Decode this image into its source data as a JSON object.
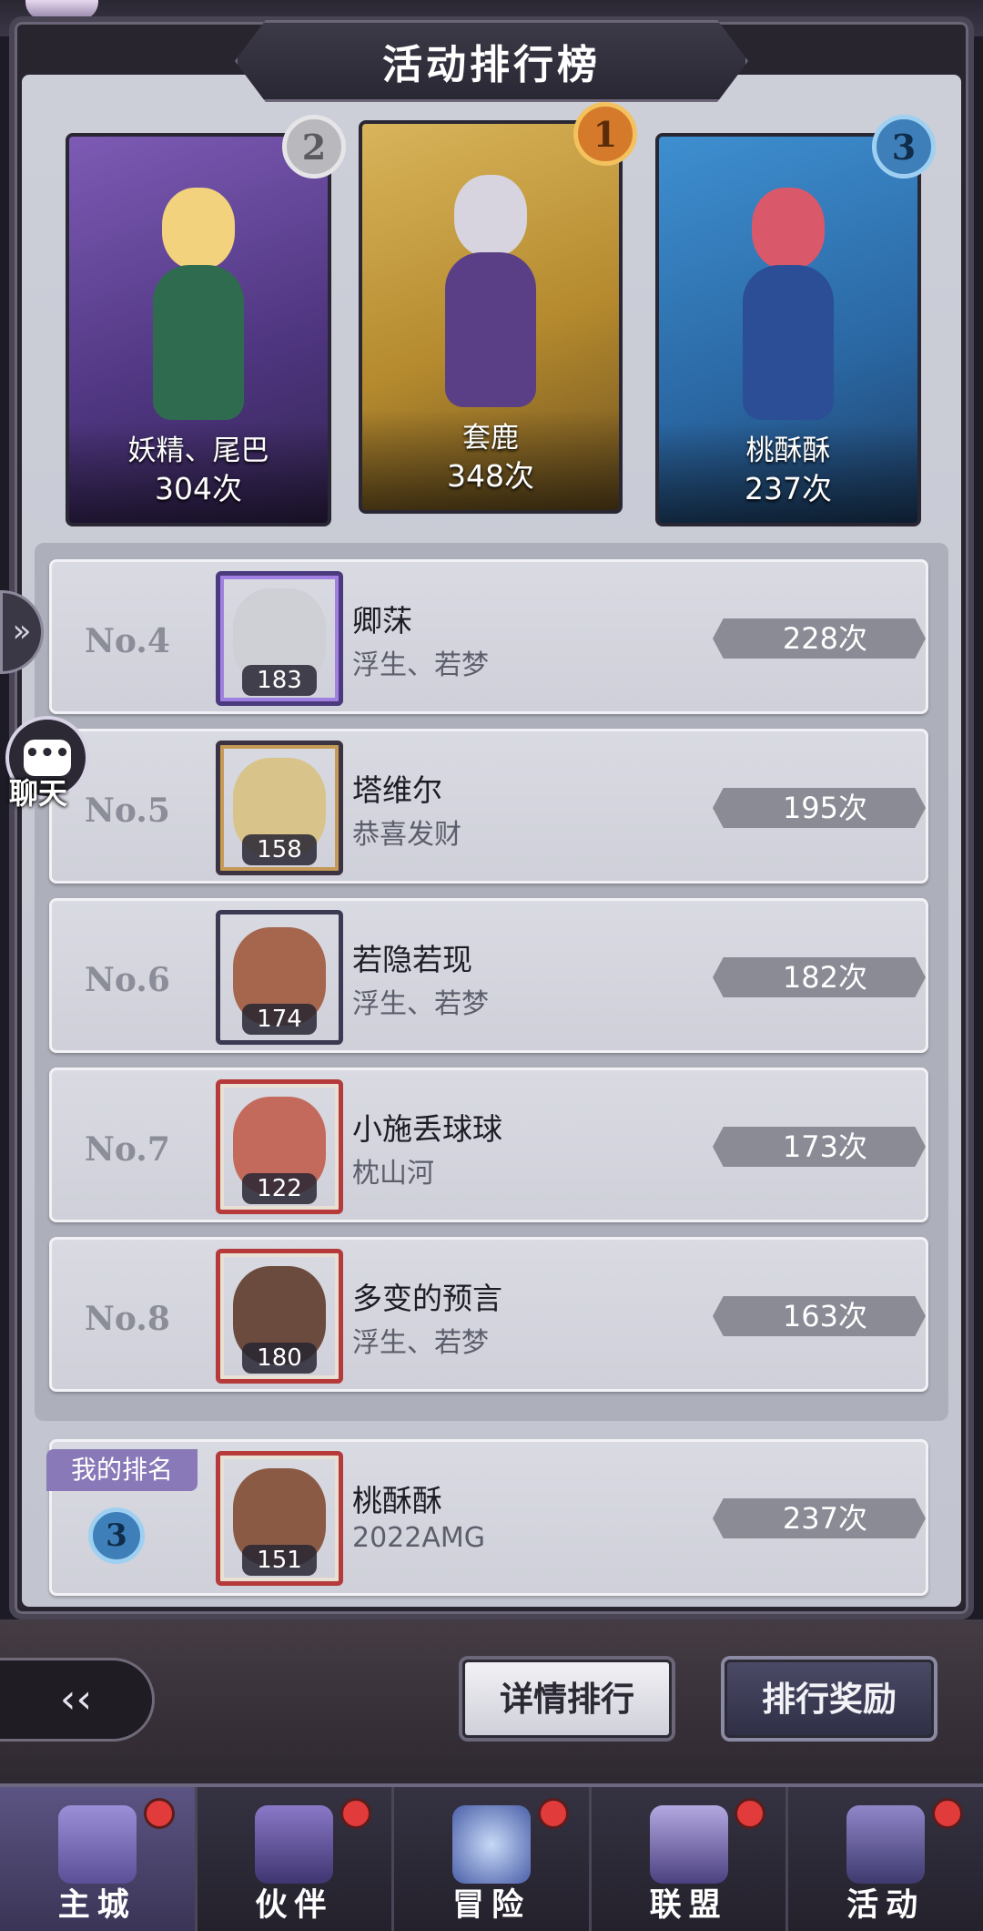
{
  "title": "活动排行榜",
  "podium": [
    {
      "rank": "2",
      "name": "妖精、尾巴",
      "count": "304次"
    },
    {
      "rank": "1",
      "name": "套鹿",
      "count": "348次"
    },
    {
      "rank": "3",
      "name": "桃酥酥",
      "count": "237次"
    }
  ],
  "rows": [
    {
      "rank": "No.4",
      "level": "183",
      "name": "卿莯",
      "sub": "浮生、若梦",
      "count": "228次"
    },
    {
      "rank": "No.5",
      "level": "158",
      "name": "塔维尔",
      "sub": "恭喜发财",
      "count": "195次"
    },
    {
      "rank": "No.6",
      "level": "174",
      "name": "若隐若现",
      "sub": "浮生、若梦",
      "count": "182次"
    },
    {
      "rank": "No.7",
      "level": "122",
      "name": "小施丢球球",
      "sub": "枕山河",
      "count": "173次"
    },
    {
      "rank": "No.8",
      "level": "180",
      "name": "多变的预言",
      "sub": "浮生、若梦",
      "count": "163次"
    }
  ],
  "my_rank": {
    "tag": "我的排名",
    "rank": "3",
    "level": "151",
    "name": "桃酥酥",
    "sub": "2022AMG",
    "count": "237次"
  },
  "side": {
    "expand_icon": "»",
    "chat_icon": "•••",
    "chat_label": "聊天"
  },
  "buttons": {
    "back_icon": "back-arrow-icon",
    "detail_ranking": "详情排行",
    "ranking_rewards": "排行奖励"
  },
  "nav": [
    {
      "label": "主城",
      "icon": "castle-icon"
    },
    {
      "label": "伙伴",
      "icon": "witch-hat-icon"
    },
    {
      "label": "冒险",
      "icon": "compass-icon"
    },
    {
      "label": "联盟",
      "icon": "shield-icon"
    },
    {
      "label": "活动",
      "icon": "cards-icon"
    }
  ]
}
